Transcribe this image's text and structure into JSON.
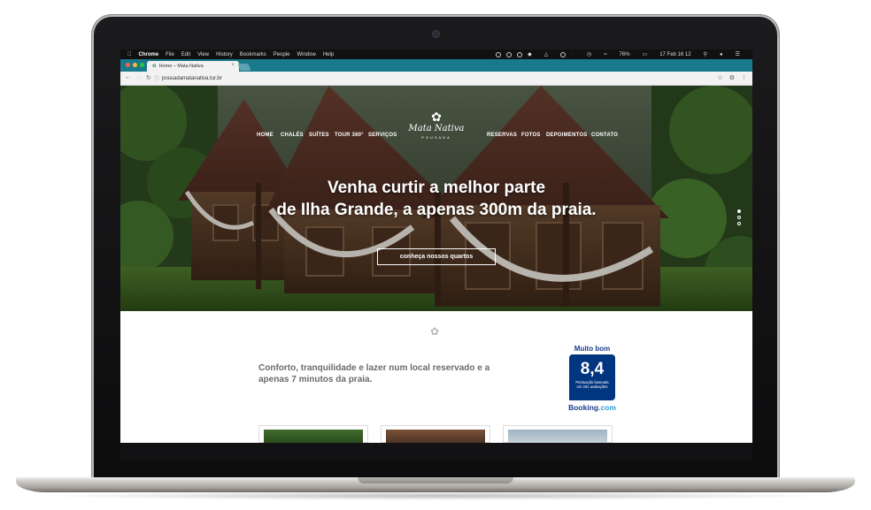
{
  "mac_menubar": {
    "app": "Chrome",
    "menus": [
      "File",
      "Edit",
      "View",
      "History",
      "Bookmarks",
      "People",
      "Window",
      "Help"
    ],
    "battery": "76%",
    "datetime": "17 Feb 16 12"
  },
  "browser": {
    "tab_title": "Home – Mata Nativa",
    "url": "pousadamatanativa.tur.br"
  },
  "site": {
    "nav_left": [
      "HOME",
      "CHALÉS",
      "SUÍTES",
      "TOUR 360°",
      "SERVIÇOS"
    ],
    "nav_right": [
      "RESERVAS",
      "FOTOS",
      "DEPOIMENTOS",
      "CONTATO"
    ],
    "logo_name": "Mata Nativa",
    "logo_sub": "POUSADA",
    "headline_line1": "Venha curtir a melhor parte",
    "headline_line2": "de Ilha Grande, a apenas 300m da praia.",
    "cta_label": "conheça nossos quartos",
    "tagline": "Conforto, tranquilidade e lazer num local reservado e a apenas 7 minutos da praia.",
    "booking": {
      "label": "Muito bom",
      "score": "8,4",
      "line1": "Pontuação baseada",
      "line2": "em 291 avaliações",
      "brand_a": "Booking",
      "brand_b": ".com"
    }
  },
  "colors": {
    "tabbar": "#1a7a8c",
    "booking_blue": "#003580"
  }
}
